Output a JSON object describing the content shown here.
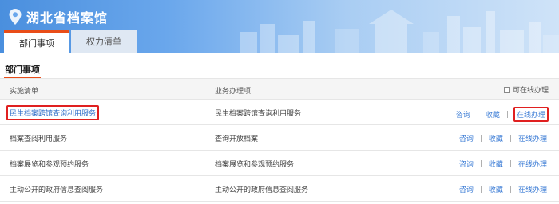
{
  "site": {
    "title": "湖北省档案馆"
  },
  "tabs": [
    {
      "label": "部门事项",
      "active": true
    },
    {
      "label": "权力清单",
      "active": false
    }
  ],
  "section": {
    "title": "部门事项"
  },
  "table": {
    "headers": {
      "name": "实施清单",
      "item": "业务办理项",
      "online_filter": "可在线办理"
    },
    "rows": [
      {
        "name": "民生档案跨馆查询利用服务",
        "item": "民生档案跨馆查询利用服务",
        "actions": [
          "咨询",
          "收藏",
          "在线办理"
        ]
      },
      {
        "name": "档案查阅利用服务",
        "item": "查询开放档案",
        "actions": [
          "咨询",
          "收藏",
          "在线办理"
        ]
      },
      {
        "name": "档案展览和参观预约服务",
        "item": "档案展览和参观预约服务",
        "actions": [
          "咨询",
          "收藏",
          "在线办理"
        ]
      },
      {
        "name": "主动公开的政府信息查阅服务",
        "item": "主动公开的政府信息查阅服务",
        "actions": [
          "咨询",
          "收藏",
          "在线办理"
        ]
      }
    ],
    "separator": "|"
  },
  "colors": {
    "accent": "#e94d18",
    "link": "#3a7bd5",
    "highlight_border": "#e02020",
    "banner": "#4a8fde"
  },
  "icons": {
    "logo": "location-pin-icon",
    "filter": "checkbox-icon"
  }
}
